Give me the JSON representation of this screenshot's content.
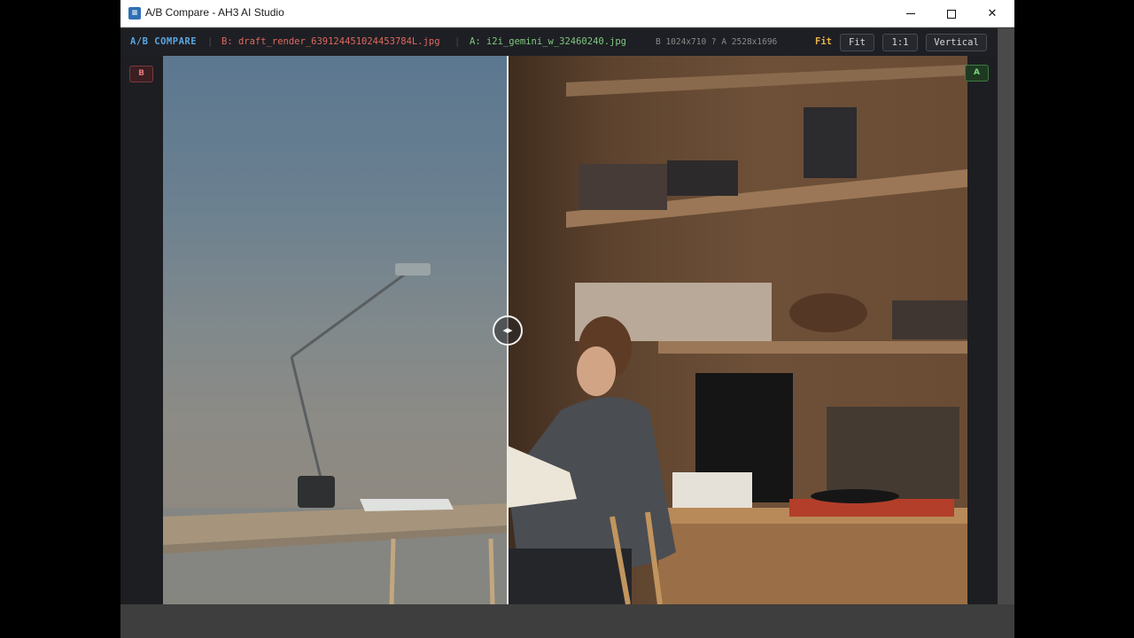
{
  "window": {
    "title": "A/B Compare - AH3 AI Studio",
    "app_icon": "app-logo-icon",
    "controls": {
      "minimize": "minimize-icon",
      "maximize": "maximize-icon",
      "close": "close-icon"
    },
    "close_glyph": "✕"
  },
  "toolbar": {
    "title": "A/B COMPARE",
    "separator": "|",
    "image_b": "B: draft_render_639124451024453784L.jpg",
    "image_a": "A: i2i_gemini_w_32460240.jpg",
    "dimensions": "B 1024x710 ? A 2528x1696",
    "fit_label": "Fit",
    "fit_button": "Fit",
    "one_to_one_button": "1:1",
    "orientation_button": "Vertical"
  },
  "compare": {
    "label_b": "B",
    "label_a": "A",
    "handle_glyph": "◂▸",
    "handle_icon": "split-handle-icon"
  },
  "colors": {
    "toolbar_bg": "#1e1f24",
    "accent_title": "#5aa6e0",
    "image_b_color": "#e0685e",
    "image_a_color": "#7fc97f",
    "fit_label_color": "#e8b34a"
  }
}
